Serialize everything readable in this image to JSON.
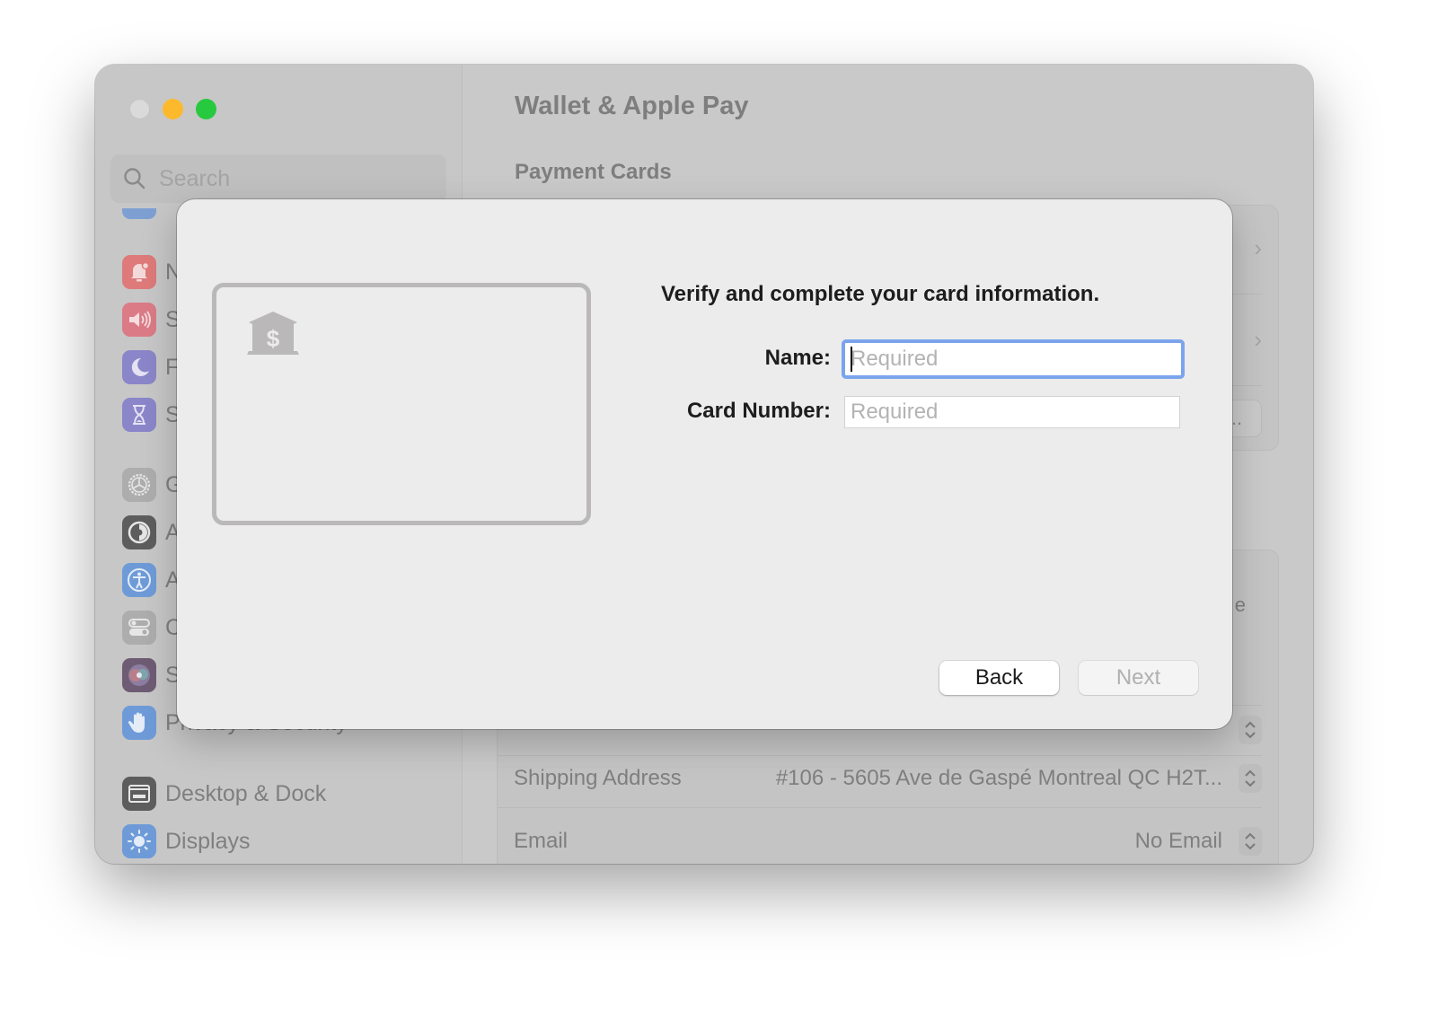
{
  "window": {
    "traffic_lights": {
      "close": "#dadada",
      "minimize": "#fdb92c",
      "maximize": "#27c93f"
    }
  },
  "sidebar": {
    "search_placeholder": "Search",
    "items": [
      {
        "label": "N",
        "icon": "bell-icon",
        "color": "#de7a7a"
      },
      {
        "label": "S",
        "icon": "speaker-icon",
        "color": "#db7b86"
      },
      {
        "label": "F",
        "icon": "moon-icon",
        "color": "#8a86c9"
      },
      {
        "label": "S",
        "icon": "hourglass-icon",
        "color": "#8a86c9"
      },
      {
        "label": "G",
        "icon": "gear-icon",
        "color": "#adadad"
      },
      {
        "label": "A",
        "icon": "appearance-icon",
        "color": "#5d5d5d"
      },
      {
        "label": "A",
        "icon": "accessibility-icon",
        "color": "#6e9bd8"
      },
      {
        "label": "C",
        "icon": "control-center-icon",
        "color": "#adadad"
      },
      {
        "label": "S",
        "icon": "siri-icon",
        "color": "#8a6f8f"
      },
      {
        "label": "Privacy & Security",
        "icon": "hand-icon",
        "color": "#6e9bd8"
      },
      {
        "label": "Desktop & Dock",
        "icon": "dock-icon",
        "color": "#5d5d5d"
      },
      {
        "label": "Displays",
        "icon": "sun-icon",
        "color": "#6e9bd8"
      }
    ]
  },
  "main": {
    "title": "Wallet & Apple Pay",
    "section_title": "Payment Cards",
    "partial_text_right": "e",
    "more_button_label": "...",
    "rows": [
      {
        "label": "Shipping Address",
        "value": "#106 - 5605 Ave de Gaspé Montreal QC H2T..."
      },
      {
        "label": "Email",
        "value": "No Email"
      }
    ]
  },
  "sheet": {
    "prompt": "Verify and complete your card information.",
    "fields": [
      {
        "label": "Name:",
        "placeholder": "Required",
        "value": "",
        "focused": true
      },
      {
        "label": "Card Number:",
        "placeholder": "Required",
        "value": "",
        "focused": false
      }
    ],
    "card_icon": "bank-dollar-icon",
    "buttons": {
      "back": "Back",
      "next": "Next"
    },
    "accent_focus": "#7ba4ec"
  }
}
